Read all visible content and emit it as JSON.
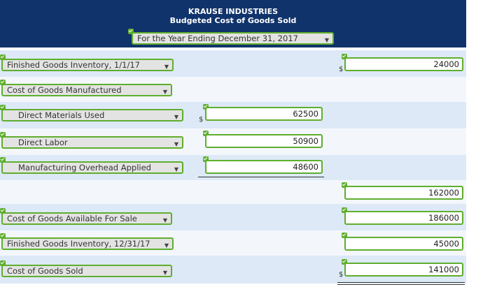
{
  "header": {
    "company": "KRAUSE INDUSTRIES",
    "statement": "Budgeted Cost of Goods Sold",
    "period": "For the Year Ending December 31, 2017"
  },
  "rows": [
    {
      "label": "Finished Goods Inventory, 1/1/17",
      "amount": "24000",
      "currency": "$"
    },
    {
      "label": "Cost of Goods Manufactured"
    },
    {
      "label": "Direct Materials Used",
      "amount": "62500",
      "currency": "$"
    },
    {
      "label": "Direct Labor",
      "amount": "50900"
    },
    {
      "label": "Manufacturing Overhead Applied",
      "amount": "48600"
    },
    {
      "label": "",
      "amount": "162000"
    },
    {
      "label": "Cost of Goods Available For Sale",
      "amount": "186000"
    },
    {
      "label": "Finished Goods Inventory, 12/31/17",
      "amount": "45000"
    },
    {
      "label": "Cost of Goods Sold",
      "amount": "141000",
      "currency": "$"
    }
  ],
  "icons": {
    "dropdown": "caret-down-icon",
    "check": "check-icon"
  },
  "colors": {
    "header": "#10336b",
    "accent": "#5fae2d"
  }
}
